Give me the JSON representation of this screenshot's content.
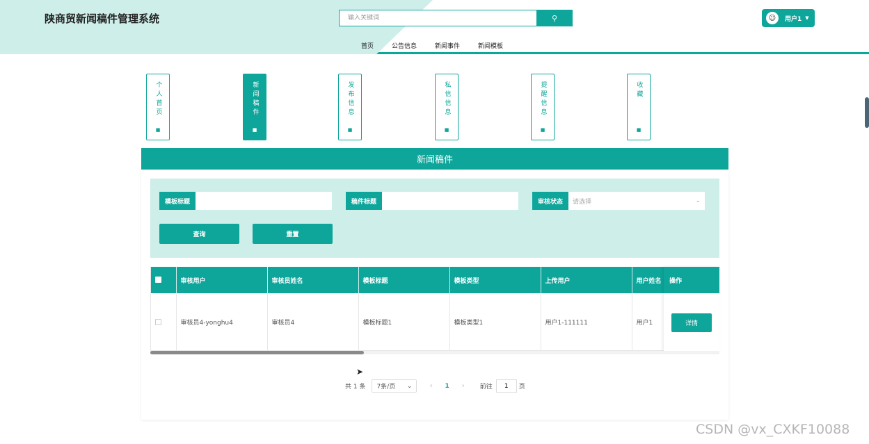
{
  "header": {
    "title": "陕商贸新闻稿件管理系统",
    "search_placeholder": "输入关键词",
    "user_name": "用户1"
  },
  "nav": [
    "首页",
    "公告信息",
    "新闻事件",
    "新闻模板"
  ],
  "side_menu": [
    {
      "label": "个人首页",
      "active": false
    },
    {
      "label": "新闻稿件",
      "active": true
    },
    {
      "label": "发布信息",
      "active": false
    },
    {
      "label": "私信信息",
      "active": false
    },
    {
      "label": "提醒信息",
      "active": false
    },
    {
      "label": "收藏",
      "active": false
    }
  ],
  "panel": {
    "title": "新闻稿件",
    "filters": {
      "template_title_label": "模板标题",
      "draft_title_label": "稿件标题",
      "review_status_label": "审核状态",
      "review_status_placeholder": "请选择"
    },
    "buttons": {
      "query": "查询",
      "reset": "重置"
    }
  },
  "table": {
    "columns": [
      "审核用户",
      "审核员姓名",
      "模板标题",
      "模板类型",
      "上传用户",
      "用户姓名",
      "操作"
    ],
    "rows": [
      {
        "reviewer": "审核员4-yonghu4",
        "reviewer_name": "审核员4",
        "template_title": "模板标题1",
        "template_type": "模板类型1",
        "uploader": "用户1-111111",
        "user_name": "用户1",
        "action": "详情"
      }
    ]
  },
  "pagination": {
    "total_text": "共 1 条",
    "page_size": "7条/页",
    "current_page": "1",
    "goto_label": "前往",
    "goto_value": "1",
    "page_suffix": "页"
  },
  "watermark": "CSDN @vx_CXKF10088",
  "colors": {
    "accent": "#0ea59a",
    "band": "#cdeee9"
  }
}
